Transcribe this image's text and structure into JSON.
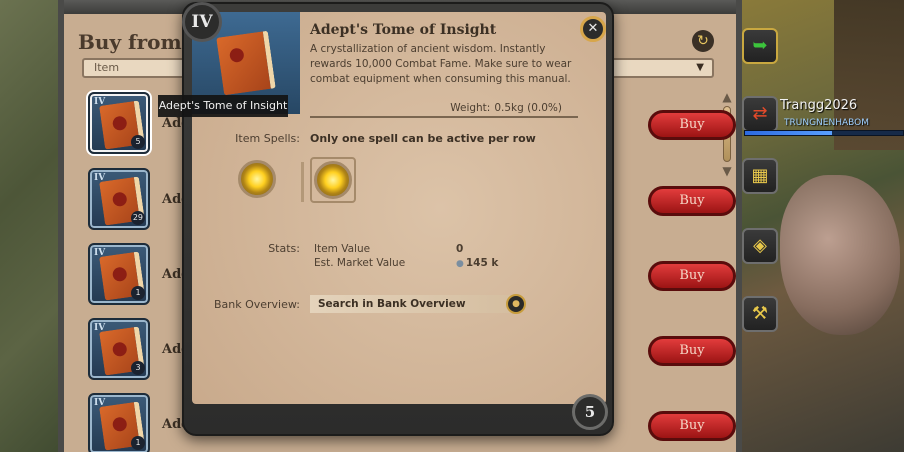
{
  "shop": {
    "title": "Buy from M",
    "filter_value": "Item",
    "rows": [
      {
        "tier": "IV",
        "qty": "5",
        "name": "Adep",
        "buy": "Buy"
      },
      {
        "tier": "IV",
        "qty": "29",
        "name": "Adep",
        "buy": "Buy"
      },
      {
        "tier": "IV",
        "qty": "1",
        "name": "Adep",
        "buy": "Buy"
      },
      {
        "tier": "IV",
        "qty": "3",
        "name": "Adep",
        "buy": "Buy"
      },
      {
        "tier": "IV",
        "qty": "1",
        "name": "Adep",
        "buy": "Buy"
      }
    ]
  },
  "hover_tooltip": "Adept's Tome of Insight",
  "detail": {
    "tier": "IV",
    "title": "Adept's Tome of Insight",
    "description": "A crystallization of ancient wisdom. Instantly rewards 10,000 Combat Fame. Make sure to wear combat equipment when consuming this manual.",
    "weight_label": "Weight:",
    "weight_value": "0.5kg (0.0%)",
    "item_spells_label": "Item Spells:",
    "spells_note": "Only one spell can be active per row",
    "stats_label": "Stats:",
    "stats": [
      {
        "key": "Item Value",
        "value": "0"
      },
      {
        "key": "Est. Market Value",
        "value": "145 k"
      }
    ],
    "bank_label": "Bank Overview:",
    "bank_search": "Search in Bank Overview",
    "page_number": "5"
  },
  "player": {
    "name": "Trangg2026",
    "guild": "TRUNGNENHABOM",
    "hp_fraction": 0.55
  },
  "icons": {
    "close": "close-icon",
    "refresh": "refresh-icon",
    "back": "back-arrow-icon"
  },
  "colors": {
    "buy_button": "#c21f1f",
    "item_slot": "#2f4c6a",
    "panel": "#c8ad91"
  }
}
